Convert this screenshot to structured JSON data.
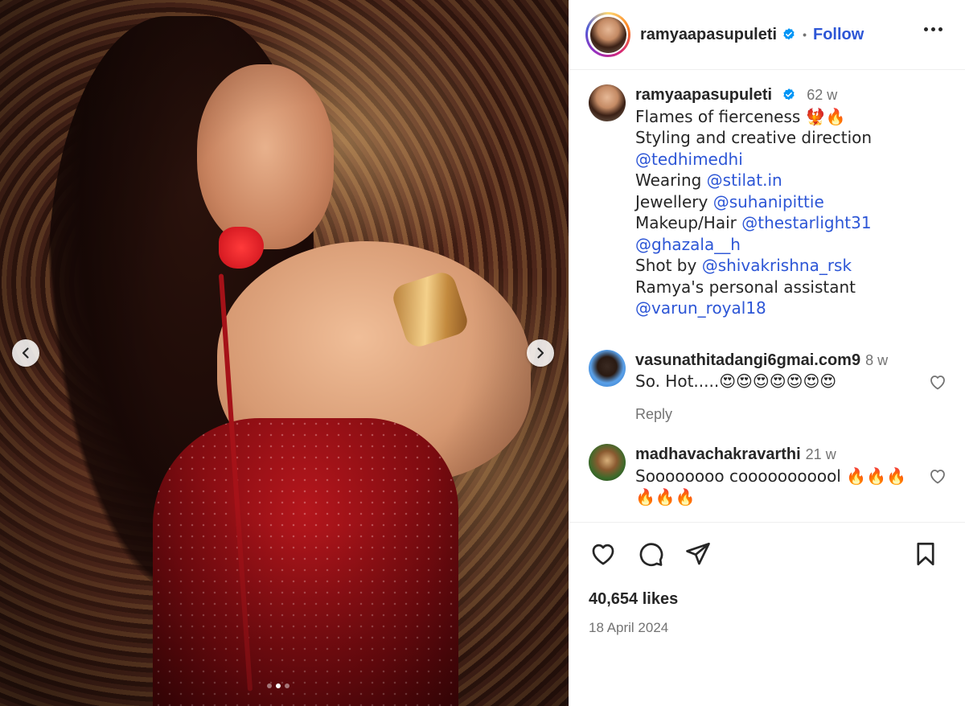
{
  "post": {
    "username": "ramyaapasupuleti",
    "follow_label": "Follow",
    "header_separator": "•",
    "carousel": {
      "slide_count": 3,
      "active_slide": 2
    }
  },
  "caption": {
    "username": "ramyaapasupuleti",
    "time": "62 w",
    "lines": [
      {
        "text": "Flames of fierceness 🐦‍🔥🔥",
        "mention": ""
      },
      {
        "text": "Styling and creative direction",
        "mention": ""
      },
      {
        "text": "",
        "mention": "@tedhimedhi"
      },
      {
        "text": "Wearing ",
        "mention": "@stilat.in"
      },
      {
        "text": "Jewellery ",
        "mention": "@suhanipittie"
      },
      {
        "text": "Makeup/Hair ",
        "mention": "@thestarlight31"
      },
      {
        "text": "",
        "mention": "@ghazala__h"
      },
      {
        "text": "Shot by ",
        "mention": "@shivakrishna_rsk"
      },
      {
        "text": "Ramya's personal assistant",
        "mention": ""
      },
      {
        "text": "",
        "mention": "@varun_royal18"
      }
    ]
  },
  "comments": [
    {
      "username": "vasunathitadangi6gmai.com9",
      "time": "8 w",
      "text": "So. Hot.....😍😍😍😍😍😍😍",
      "reply_label": "Reply"
    },
    {
      "username": "madhavachakravarthi",
      "time": "21 w",
      "text": "Soooooooo cooooooooool 🔥🔥🔥🔥🔥🔥"
    }
  ],
  "stats": {
    "likes": "40,654 likes",
    "date": "18 April 2024"
  },
  "colors": {
    "link": "#2d56d6",
    "muted": "#737373",
    "verified": "#0095f6"
  }
}
